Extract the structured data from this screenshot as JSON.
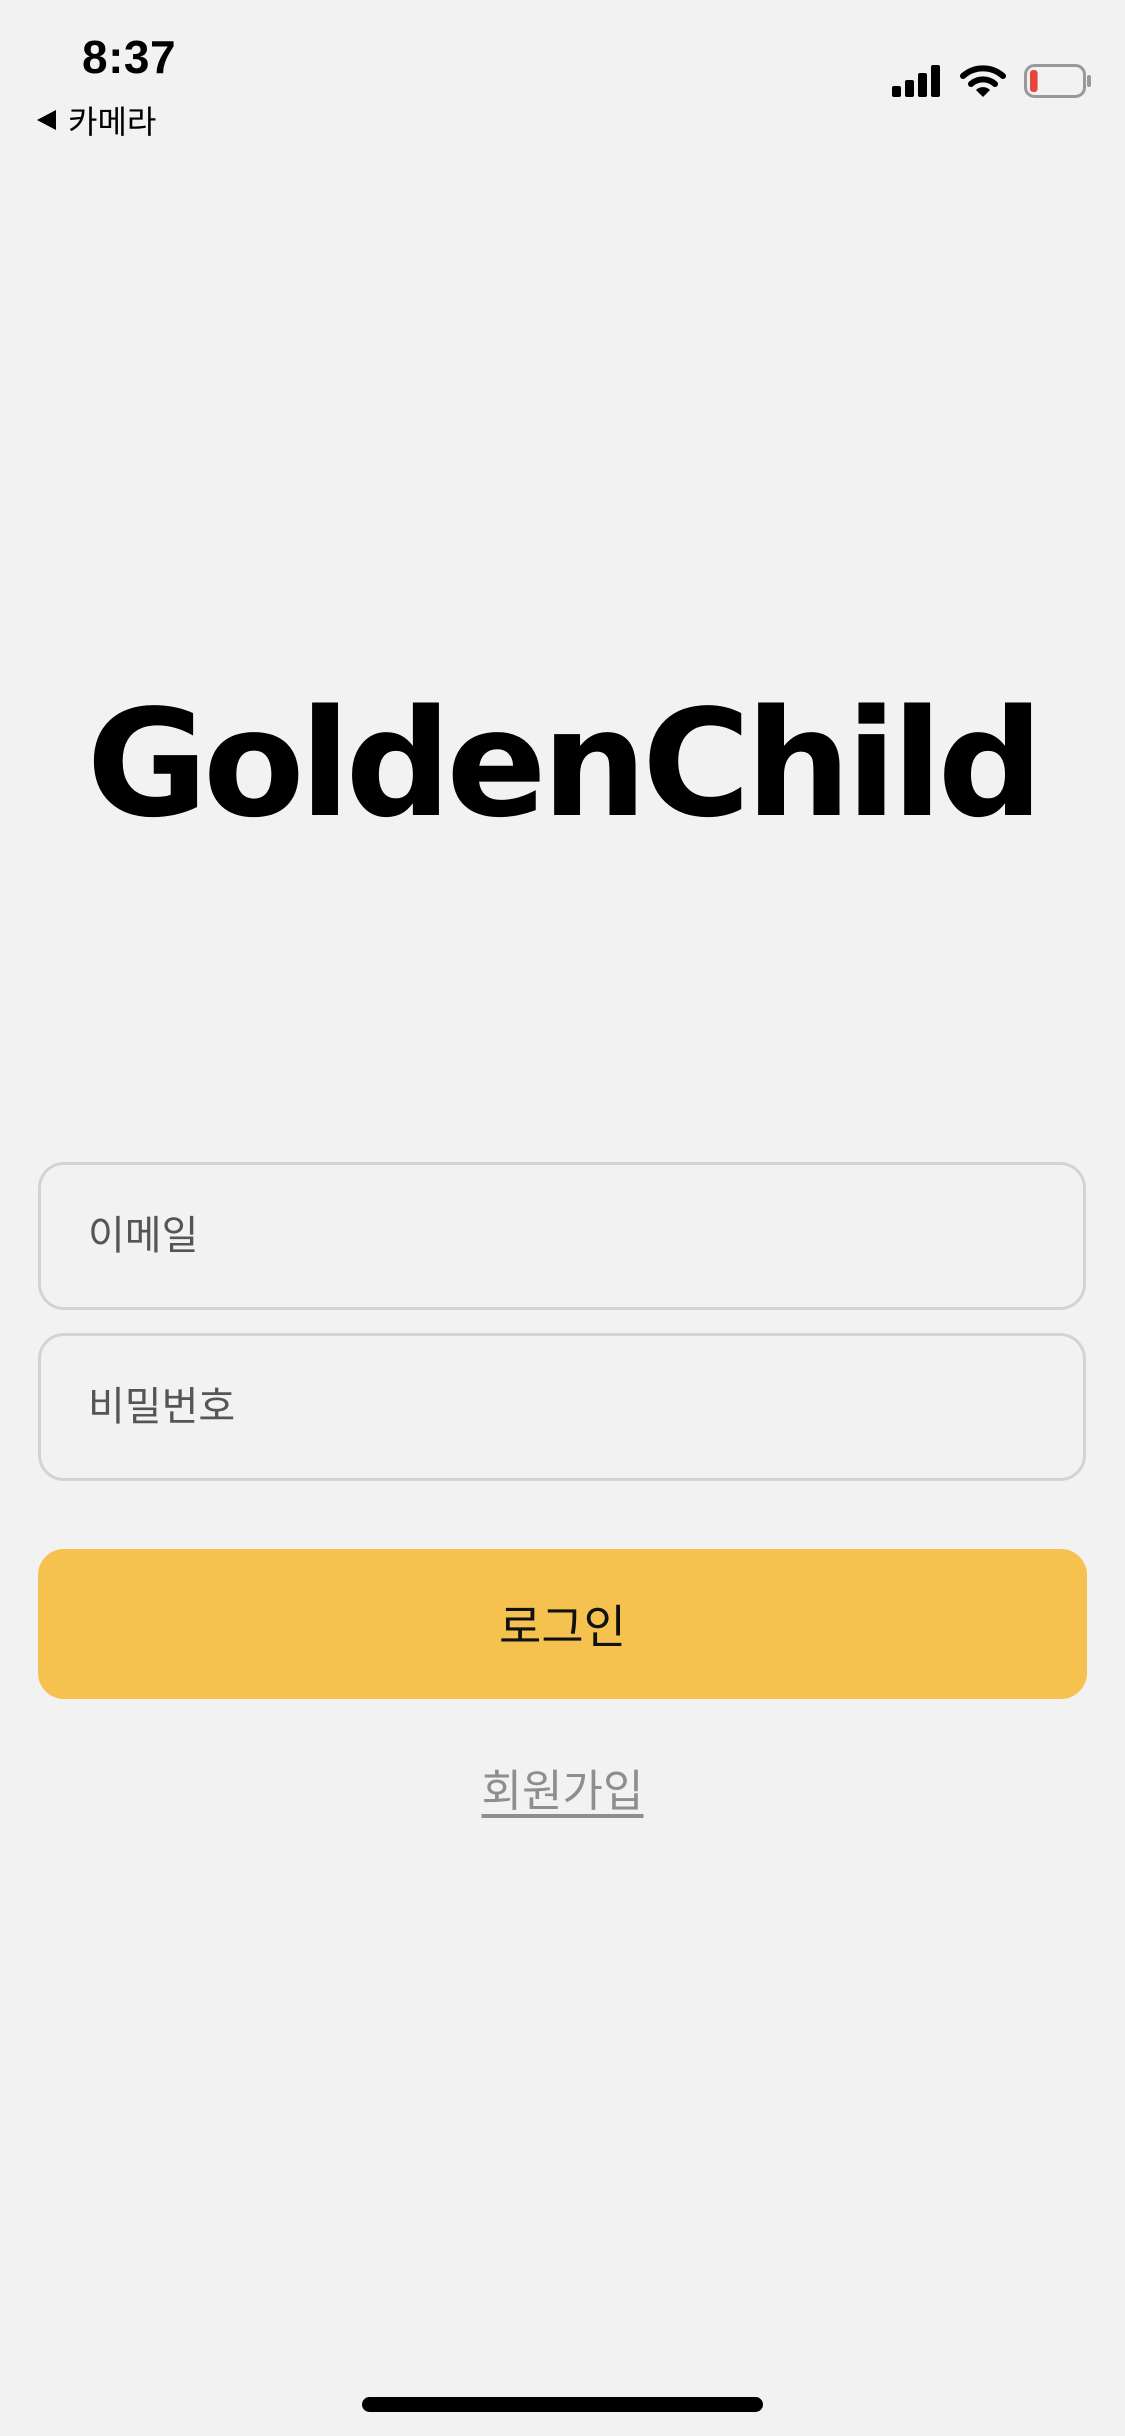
{
  "status_bar": {
    "time": "8:37",
    "back_label": "카메라",
    "icons": [
      "back-arrow-icon",
      "cellular-signal-icon",
      "wifi-icon",
      "battery-low-icon"
    ],
    "battery_level": 0.15,
    "battery_color": "#e5483b"
  },
  "brand": {
    "title": "GoldenChild"
  },
  "form": {
    "email_placeholder": "이메일",
    "password_placeholder": "비밀번호",
    "login_label": "로그인",
    "signup_label": "회원가입"
  },
  "colors": {
    "background": "#f2f2f2",
    "accent": "#f5c24f",
    "field_border": "#d3d3d3",
    "link": "#8e8e8e"
  }
}
